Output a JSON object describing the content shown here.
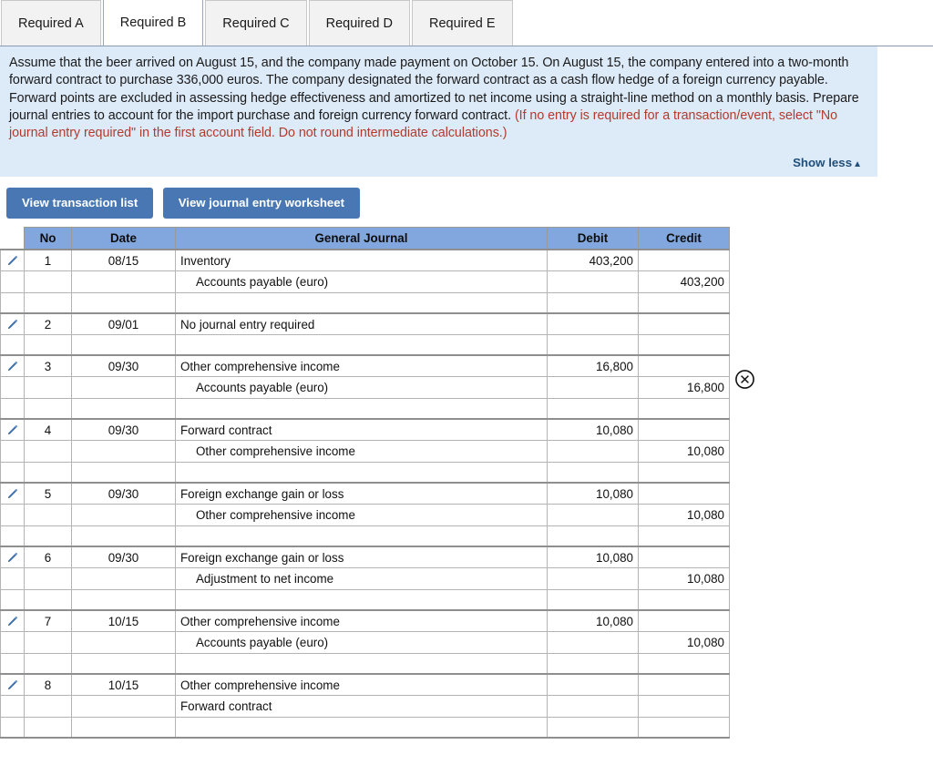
{
  "tabs": [
    {
      "label": "Required A",
      "active": false
    },
    {
      "label": "Required B",
      "active": true
    },
    {
      "label": "Required C",
      "active": false
    },
    {
      "label": "Required D",
      "active": false
    },
    {
      "label": "Required E",
      "active": false
    }
  ],
  "instructions": {
    "black_text": "Assume that the beer arrived on August 15, and the company made payment on October 15. On August 15, the company entered into a two-month forward contract to purchase 336,000 euros. The company designated the forward contract as a cash flow hedge of a foreign currency payable. Forward points are excluded in assessing hedge effectiveness and amortized to net income using a straight-line method on a monthly basis. Prepare journal entries to account for the import purchase and foreign currency forward contract. ",
    "red_text": "(If no entry is required for a transaction/event, select \"No journal entry required\" in the first account field. Do not round intermediate calculations.)",
    "show_less_label": "Show less",
    "show_less_caret": "▲"
  },
  "toolbar": {
    "view_transaction_list": "View transaction list",
    "view_journal_entry_worksheet": "View journal entry worksheet",
    "close_icon": "close-circle-icon"
  },
  "table": {
    "headers": {
      "edit": "",
      "no": "No",
      "date": "Date",
      "general_journal": "General Journal",
      "debit": "Debit",
      "credit": "Credit"
    },
    "entries": [
      {
        "no": "1",
        "date": "08/15",
        "lines": [
          {
            "account": "Inventory",
            "indent": false,
            "debit": "403,200",
            "credit": ""
          },
          {
            "account": "Accounts payable (euro)",
            "indent": true,
            "debit": "",
            "credit": "403,200"
          },
          {
            "account": "",
            "indent": false,
            "debit": "",
            "credit": ""
          }
        ]
      },
      {
        "no": "2",
        "date": "09/01",
        "lines": [
          {
            "account": "No journal entry required",
            "indent": false,
            "debit": "",
            "credit": ""
          },
          {
            "account": "",
            "indent": false,
            "debit": "",
            "credit": ""
          }
        ]
      },
      {
        "no": "3",
        "date": "09/30",
        "lines": [
          {
            "account": "Other comprehensive income",
            "indent": false,
            "debit": "16,800",
            "credit": ""
          },
          {
            "account": "Accounts payable (euro)",
            "indent": true,
            "debit": "",
            "credit": "16,800"
          },
          {
            "account": "",
            "indent": false,
            "debit": "",
            "credit": ""
          }
        ]
      },
      {
        "no": "4",
        "date": "09/30",
        "lines": [
          {
            "account": "Forward contract",
            "indent": false,
            "debit": "10,080",
            "credit": ""
          },
          {
            "account": "Other comprehensive income",
            "indent": true,
            "debit": "",
            "credit": "10,080"
          },
          {
            "account": "",
            "indent": false,
            "debit": "",
            "credit": ""
          }
        ]
      },
      {
        "no": "5",
        "date": "09/30",
        "lines": [
          {
            "account": "Foreign exchange gain or loss",
            "indent": false,
            "debit": "10,080",
            "credit": ""
          },
          {
            "account": "Other comprehensive income",
            "indent": true,
            "debit": "",
            "credit": "10,080"
          },
          {
            "account": "",
            "indent": false,
            "debit": "",
            "credit": ""
          }
        ]
      },
      {
        "no": "6",
        "date": "09/30",
        "lines": [
          {
            "account": "Foreign exchange gain or loss",
            "indent": false,
            "debit": "10,080",
            "credit": ""
          },
          {
            "account": "Adjustment to net income",
            "indent": true,
            "debit": "",
            "credit": "10,080"
          },
          {
            "account": "",
            "indent": false,
            "debit": "",
            "credit": ""
          }
        ]
      },
      {
        "no": "7",
        "date": "10/15",
        "lines": [
          {
            "account": "Other comprehensive income",
            "indent": false,
            "debit": "10,080",
            "credit": ""
          },
          {
            "account": "Accounts payable (euro)",
            "indent": true,
            "debit": "",
            "credit": "10,080"
          },
          {
            "account": "",
            "indent": false,
            "debit": "",
            "credit": ""
          }
        ]
      },
      {
        "no": "8",
        "date": "10/15",
        "lines": [
          {
            "account": "Other comprehensive income",
            "indent": false,
            "debit": "",
            "credit": ""
          },
          {
            "account": "Forward contract",
            "indent": false,
            "debit": "",
            "credit": ""
          },
          {
            "account": "",
            "indent": false,
            "debit": "",
            "credit": ""
          }
        ]
      }
    ],
    "edit_icon": "pencil-icon"
  },
  "colors": {
    "panel_bg": "#ddeaf8",
    "header_blue": "#81a7de",
    "button_blue": "#4877b4",
    "red_text": "#b23b2e",
    "link_blue": "#1f4e79"
  }
}
